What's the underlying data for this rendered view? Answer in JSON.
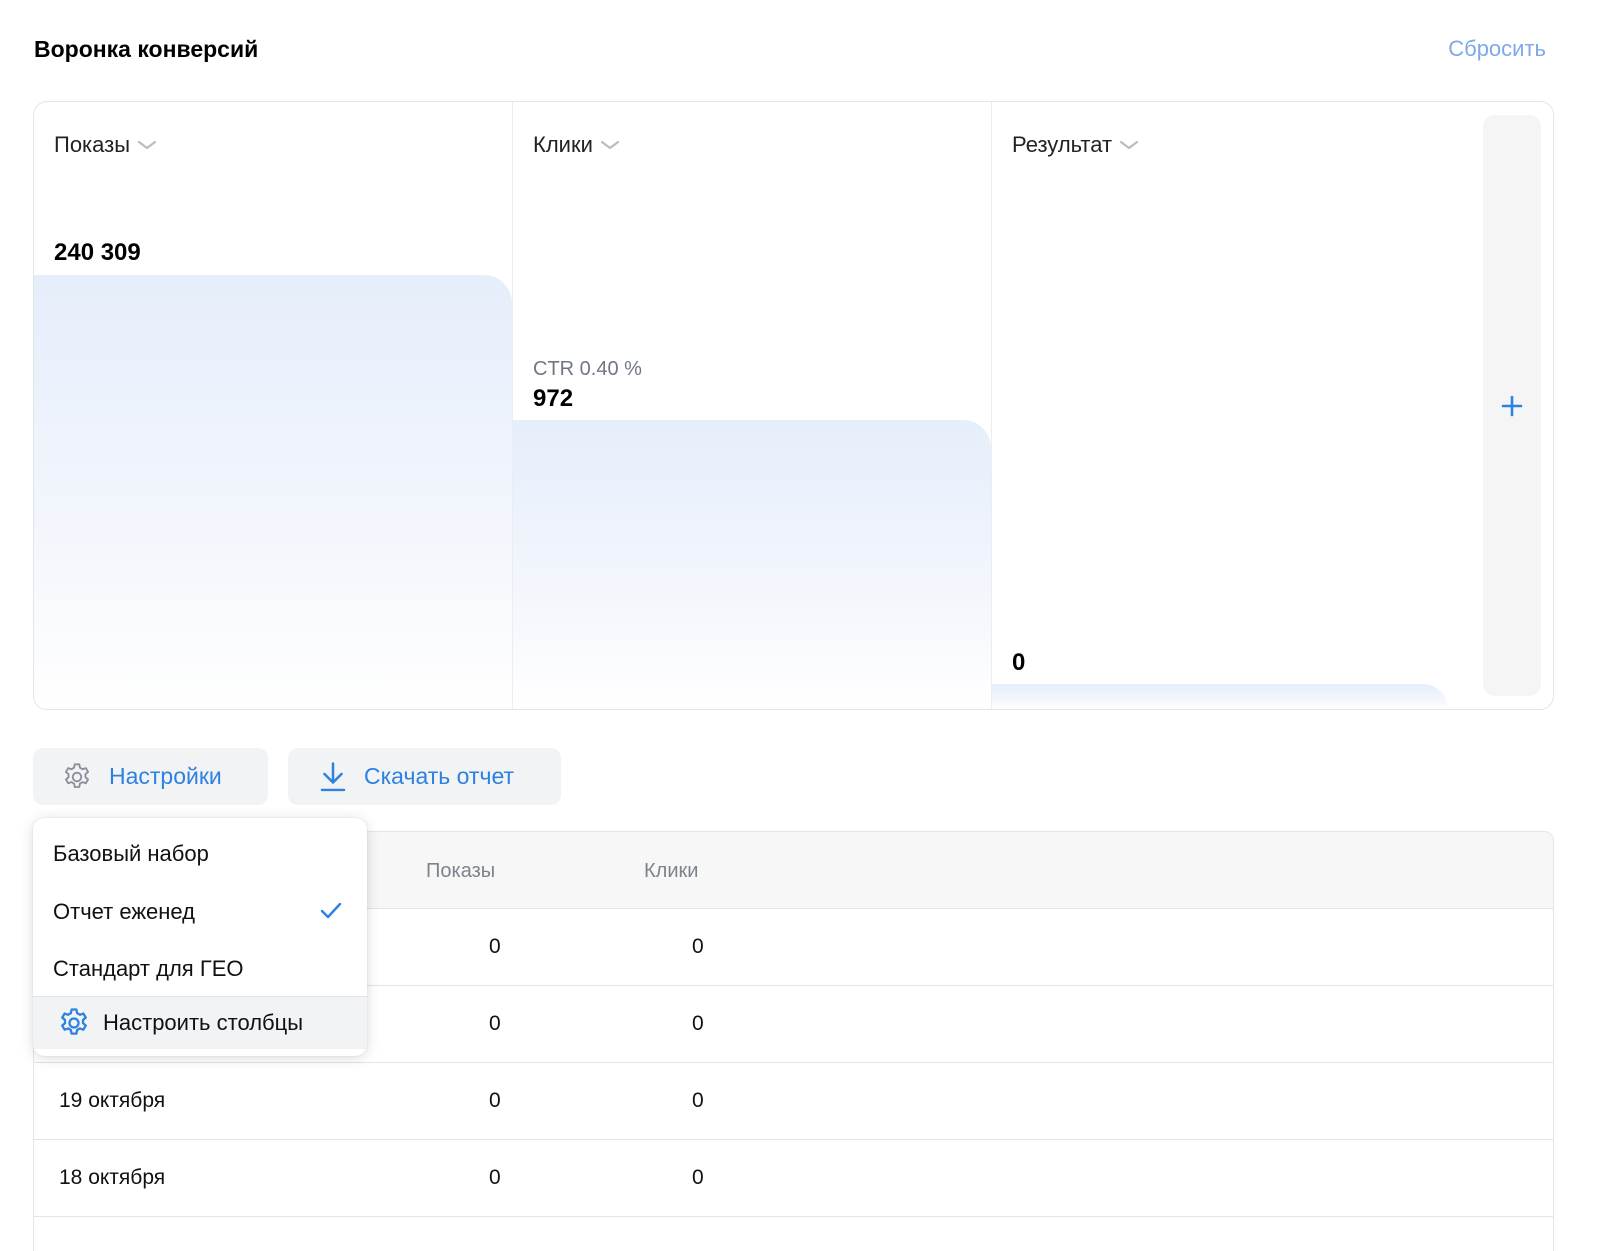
{
  "header": {
    "title": "Воронка конверсий",
    "reset_label": "Сбросить"
  },
  "funnel": {
    "columns": [
      {
        "label": "Показы",
        "value": "240 309",
        "metric": ""
      },
      {
        "label": "Клики",
        "value": "972",
        "metric": "CTR 0.40 %"
      },
      {
        "label": "Результат",
        "value": "0",
        "metric": ""
      }
    ],
    "add_column_icon": "plus-icon"
  },
  "toolbar": {
    "settings_label": "Настройки",
    "settings_icon": "gear-icon",
    "download_label": "Скачать отчет",
    "download_icon": "download-icon"
  },
  "dropdown": {
    "items": [
      {
        "label": "Базовый набор",
        "selected": false
      },
      {
        "label": "Отчет еженед",
        "selected": true
      },
      {
        "label": "Стандарт для ГЕО",
        "selected": false
      }
    ],
    "footer_label": "Настроить столбцы",
    "footer_icon": "gear-icon"
  },
  "table": {
    "headers": [
      "Показы",
      "Клики"
    ],
    "rows": [
      {
        "date": "",
        "shows": "0",
        "clicks": "0"
      },
      {
        "date": "",
        "shows": "0",
        "clicks": "0"
      },
      {
        "date": "19 октября",
        "shows": "0",
        "clicks": "0"
      },
      {
        "date": "18 октября",
        "shows": "0",
        "clicks": "0"
      }
    ]
  },
  "colors": {
    "accent": "#2d81e0",
    "reset": "#7ea9e6",
    "bar_top": "#e6eefb"
  }
}
